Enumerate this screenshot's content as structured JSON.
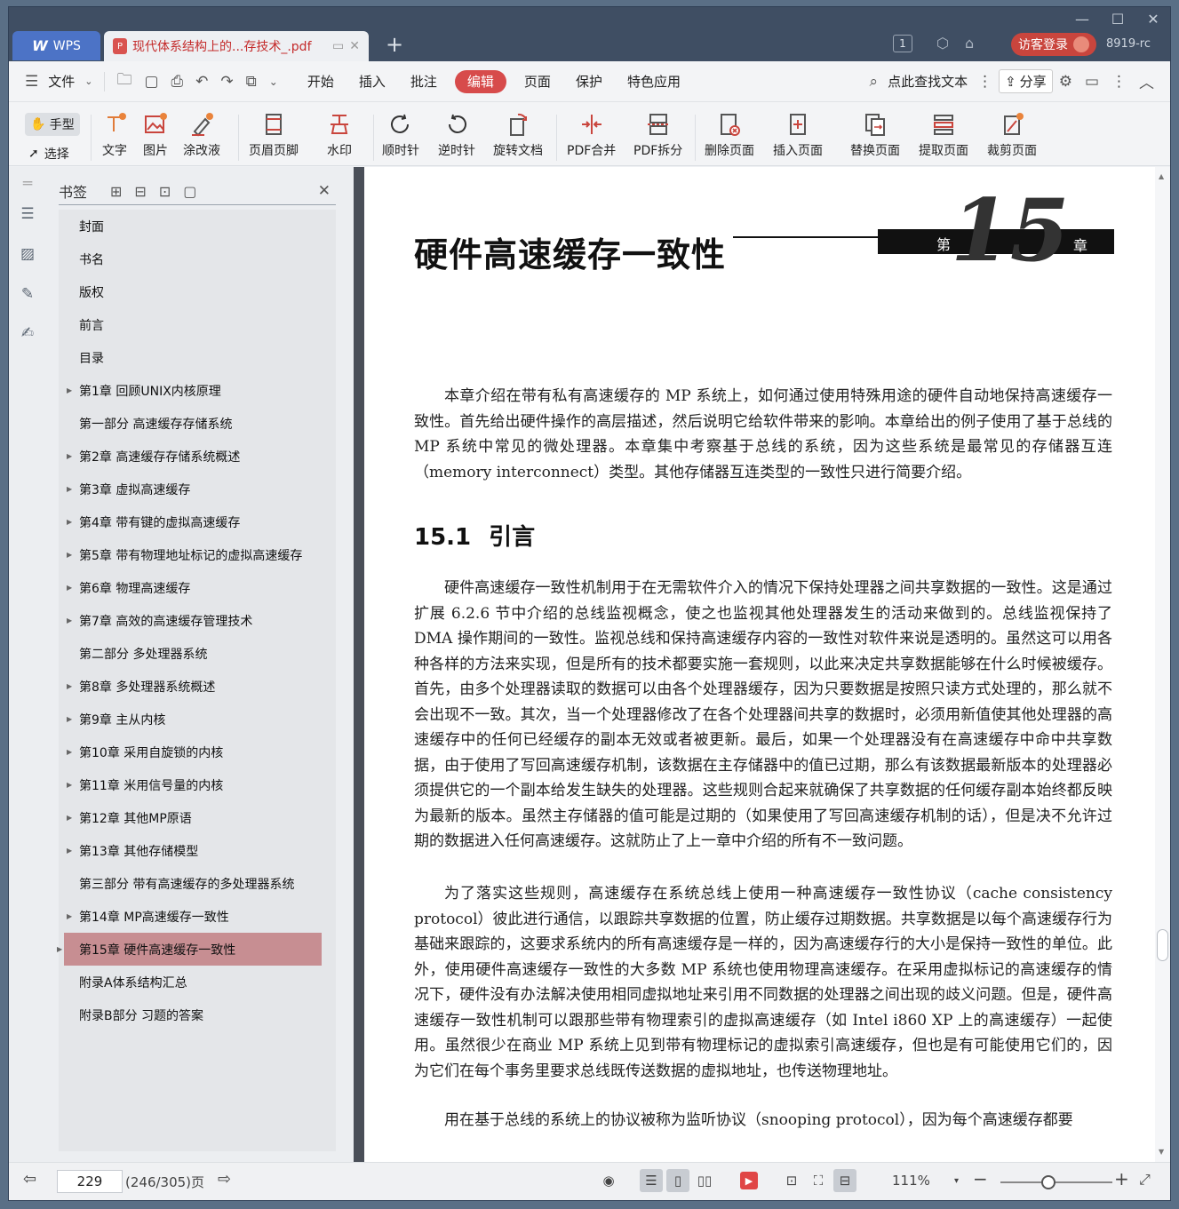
{
  "window": {
    "app_tab_label": "WPS",
    "doc_tab_title": "现代体系结构上的...存技术_.pdf",
    "page_badge": "1",
    "login_label": "访客登录",
    "version": "8919-rc"
  },
  "menu": {
    "file_label": "文件",
    "items": [
      "开始",
      "插入",
      "批注",
      "编辑",
      "页面",
      "保护",
      "特色应用"
    ],
    "active": "编辑",
    "search_label": "点此查找文本",
    "share_label": "分享"
  },
  "toolbar": {
    "hand_label": "手型",
    "select_label": "选择",
    "tools": [
      "文字",
      "图片",
      "涂改液",
      "页眉页脚",
      "水印",
      "顺时针",
      "逆时针",
      "旋转文档",
      "PDF合并",
      "PDF拆分",
      "删除页面",
      "插入页面",
      "替换页面",
      "提取页面",
      "裁剪页面"
    ]
  },
  "bookmarks": {
    "title": "书签",
    "items": [
      {
        "label": "封面",
        "expandable": false
      },
      {
        "label": "书名",
        "expandable": false
      },
      {
        "label": "版权",
        "expandable": false
      },
      {
        "label": "前言",
        "expandable": false
      },
      {
        "label": "目录",
        "expandable": false
      },
      {
        "label": "第1章 回顾UNIX内核原理",
        "expandable": true
      },
      {
        "label": "第一部分 高速缓存存储系统",
        "expandable": false
      },
      {
        "label": "第2章 高速缓存存储系统概述",
        "expandable": true
      },
      {
        "label": "第3章 虚拟高速缓存",
        "expandable": true
      },
      {
        "label": "第4章 带有键的虚拟高速缓存",
        "expandable": true
      },
      {
        "label": "第5章 带有物理地址标记的虚拟高速缓存",
        "expandable": true
      },
      {
        "label": "第6章 物理高速缓存",
        "expandable": true
      },
      {
        "label": "第7章 高效的高速缓存管理技术",
        "expandable": true
      },
      {
        "label": "第二部分 多处理器系统",
        "expandable": false
      },
      {
        "label": "第8章 多处理器系统概述",
        "expandable": true
      },
      {
        "label": "第9章 主从内核",
        "expandable": true
      },
      {
        "label": "第10章 采用自旋锁的内核",
        "expandable": true
      },
      {
        "label": "第11章 米用信号量的内核",
        "expandable": true
      },
      {
        "label": "第12章 其他MP原语",
        "expandable": true
      },
      {
        "label": "第13章 其他存储模型",
        "expandable": true
      },
      {
        "label": "第三部分 带有高速缓存的多处理器系统",
        "expandable": false
      },
      {
        "label": "第14章 MP高速缓存一致性",
        "expandable": true
      },
      {
        "label": "第15章 硬件高速缓存一致性",
        "expandable": true,
        "selected": true
      },
      {
        "label": "附录A体系结构汇总",
        "expandable": false
      },
      {
        "label": "附录B部分 习题的答案",
        "expandable": false
      }
    ]
  },
  "page": {
    "chapter_title": "硬件高速缓存一致性",
    "chapter_prefix": "第",
    "chapter_number": "15",
    "chapter_suffix": "章",
    "intro": "本章介绍在带有私有高速缓存的 MP 系统上，如何通过使用特殊用途的硬件自动地保持高速缓存一致性。首先给出硬件操作的高层描述，然后说明它给软件带来的影响。本章给出的例子使用了基于总线的 MP 系统中常见的微处理器。本章集中考察基于总线的系统，因为这些系统是最常见的存储器互连（memory interconnect）类型。其他存储器互连类型的一致性只进行简要介绍。",
    "section_number": "15.1",
    "section_title": "引言",
    "para1": "硬件高速缓存一致性机制用于在无需软件介入的情况下保持处理器之间共享数据的一致性。这是通过扩展 6.2.6 节中介绍的总线监视概念，使之也监视其他处理器发生的活动来做到的。总线监视保持了 DMA 操作期间的一致性。监视总线和保持高速缓存内容的一致性对软件来说是透明的。虽然这可以用各种各样的方法来实现，但是所有的技术都要实施一套规则，以此来决定共享数据能够在什么时候被缓存。首先，由多个处理器读取的数据可以由各个处理器缓存，因为只要数据是按照只读方式处理的，那么就不会出现不一致。其次，当一个处理器修改了在各个处理器间共享的数据时，必须用新值使其他处理器的高速缓存中的任何已经缓存的副本无效或者被更新。最后，如果一个处理器没有在高速缓存中命中共享数据，由于使用了写回高速缓存机制，该数据在主存储器中的值已过期，那么有该数据最新版本的处理器必须提供它的一个副本给发生缺失的处理器。这些规则合起来就确保了共享数据的任何缓存副本始终都反映为最新的版本。虽然主存储器的值可能是过期的（如果使用了写回高速缓存机制的话），但是决不允许过期的数据进入任何高速缓存。这就防止了上一章中介绍的所有不一致问题。",
    "para2": "为了落实这些规则，高速缓存在系统总线上使用一种高速缓存一致性协议（cache consistency protocol）彼此进行通信，以跟踪共享数据的位置，防止缓存过期数据。共享数据是以每个高速缓存行为基础来跟踪的，这要求系统内的所有高速缓存是一样的，因为高速缓存行的大小是保持一致性的单位。此外，使用硬件高速缓存一致性的大多数 MP 系统也使用物理高速缓存。在采用虚拟标记的高速缓存的情况下，硬件没有办法解决使用相同虚拟地址来引用不同数据的处理器之间出现的歧义问题。但是，硬件高速缓存一致性机制可以跟那些带有物理索引的虚拟高速缓存（如 Intel i860 XP 上的高速缓存）一起使用。虽然很少在商业 MP 系统上见到带有物理标记的虚拟索引高速缓存，但也是有可能使用它们的，因为它们在每个事务里要求总线既传送数据的虚拟地址，也传送物理地址。",
    "para3": "用在基于总线的系统上的协议被称为监听协议（snooping protocol），因为每个高速缓存都要"
  },
  "status": {
    "page_input": "229",
    "page_info": "(246/305)页",
    "zoom": "111%"
  },
  "colors": {
    "titlebar": "#3f4e63",
    "accent_red": "#d74b4b",
    "wps_blue": "#4c73c6",
    "bookmark_selected": "#c78e92"
  }
}
